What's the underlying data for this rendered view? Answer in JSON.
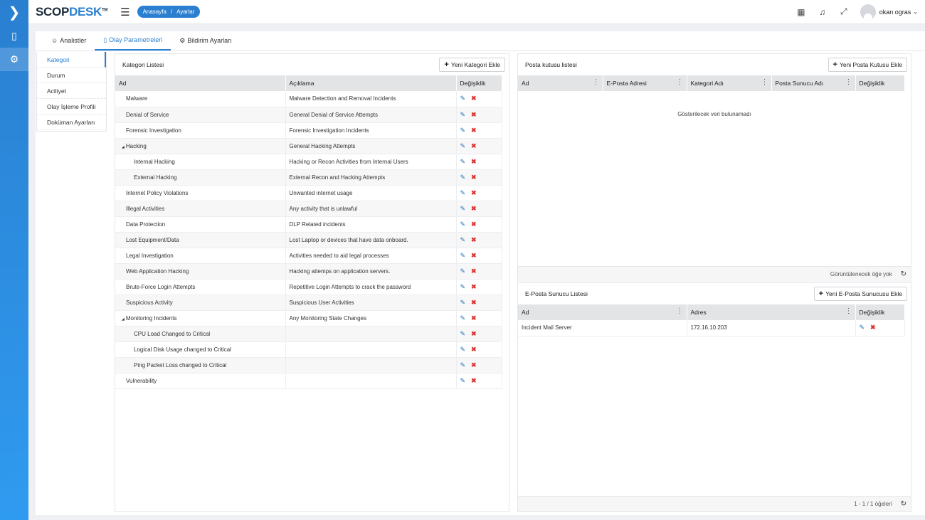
{
  "app": {
    "brand_main": "SCOP",
    "brand_accent": "DESK",
    "brand_tm": "TM",
    "accent_color": "#2a7fd0"
  },
  "breadcrumb": {
    "home": "Anasayfa",
    "separator": "/",
    "current": "Ayarlar"
  },
  "user": {
    "name": "okan ogras"
  },
  "tabs": [
    {
      "label": "Analistler",
      "icon": "user-icon"
    },
    {
      "label": "Olay Parametreleri",
      "icon": "document-icon"
    },
    {
      "label": "Bildirim Ayarları",
      "icon": "gear-icon"
    }
  ],
  "side_menu": [
    "Kategori",
    "Durum",
    "Aciliyet",
    "Olay İşleme Profili",
    "Doküman Ayarları"
  ],
  "category_panel": {
    "title": "Kategori Listesi",
    "add_button": "Yeni Kategori Ekle",
    "columns": [
      "Ad",
      "Açıklama",
      "Değişiklik"
    ],
    "rows": [
      {
        "name": "Malware",
        "desc": "Malware Detection and Removal Incidents",
        "level": 0
      },
      {
        "name": "Denial of Service",
        "desc": "General Denial of Service Attempts",
        "level": 0
      },
      {
        "name": "Forensic Investigation",
        "desc": "Forensic Investigation Incidents",
        "level": 0
      },
      {
        "name": "Hacking",
        "desc": "General Hacking Attempts",
        "level": 0,
        "expanded": true
      },
      {
        "name": "Internal Hacking",
        "desc": "Hacking or Recon Activities from Internal Users",
        "level": 1
      },
      {
        "name": "External Hacking",
        "desc": "External Recon and Hacking Attempts",
        "level": 1
      },
      {
        "name": "Internet Policy Violations",
        "desc": "Unwanted internet usage",
        "level": 0
      },
      {
        "name": "Illegal Activities",
        "desc": "Any activity that is unlawful",
        "level": 0
      },
      {
        "name": "Data Protection",
        "desc": "DLP Related incidents",
        "level": 0
      },
      {
        "name": "Lost Equipment/Data",
        "desc": "Lost Laptop or devices that have data onboard.",
        "level": 0
      },
      {
        "name": "Legal Investigation",
        "desc": "Activities needed to aid legal processes",
        "level": 0
      },
      {
        "name": "Web Application Hacking",
        "desc": "Hacking attemps on application servers.",
        "level": 0
      },
      {
        "name": "Brute-Force Login Attempts",
        "desc": "Repetitive Login Attempts to crack the password",
        "level": 0
      },
      {
        "name": "Suspicious Activity",
        "desc": "Suspicious User Activities",
        "level": 0
      },
      {
        "name": "Monitoring Incidents",
        "desc": "Any Monitoring State Changes",
        "level": 0,
        "expanded": true
      },
      {
        "name": "CPU Load Changed to Critical",
        "desc": "",
        "level": 1
      },
      {
        "name": "Logical Disk Usage changed to Critical",
        "desc": "",
        "level": 1
      },
      {
        "name": "Ping Packet Loss changed to Critical",
        "desc": "",
        "level": 1
      },
      {
        "name": "Vulnerability",
        "desc": "",
        "level": 0
      }
    ]
  },
  "mailbox_panel": {
    "title": "Posta kutusu listesi",
    "add_button": "Yeni Posta Kutusu Ekle",
    "columns": [
      "Ad",
      "E-Posta Adresi",
      "Kategori Adı",
      "Posta Sunucu Adı",
      "Değişiklik"
    ],
    "empty_text": "Gösterilecek veri bulunamadı",
    "footer_text": "Görüntülenecek öğe yok"
  },
  "mailserver_panel": {
    "title": "E-Posta Sunucu Listesi",
    "add_button": "Yeni E-Posta Sunucusu Ekle",
    "columns": [
      "Ad",
      "Adres",
      "Değişiklik"
    ],
    "rows": [
      {
        "name": "Incident Mail Server",
        "address": "172.16.10.203"
      }
    ],
    "footer_text": "1 - 1 / 1 öğeleri"
  }
}
